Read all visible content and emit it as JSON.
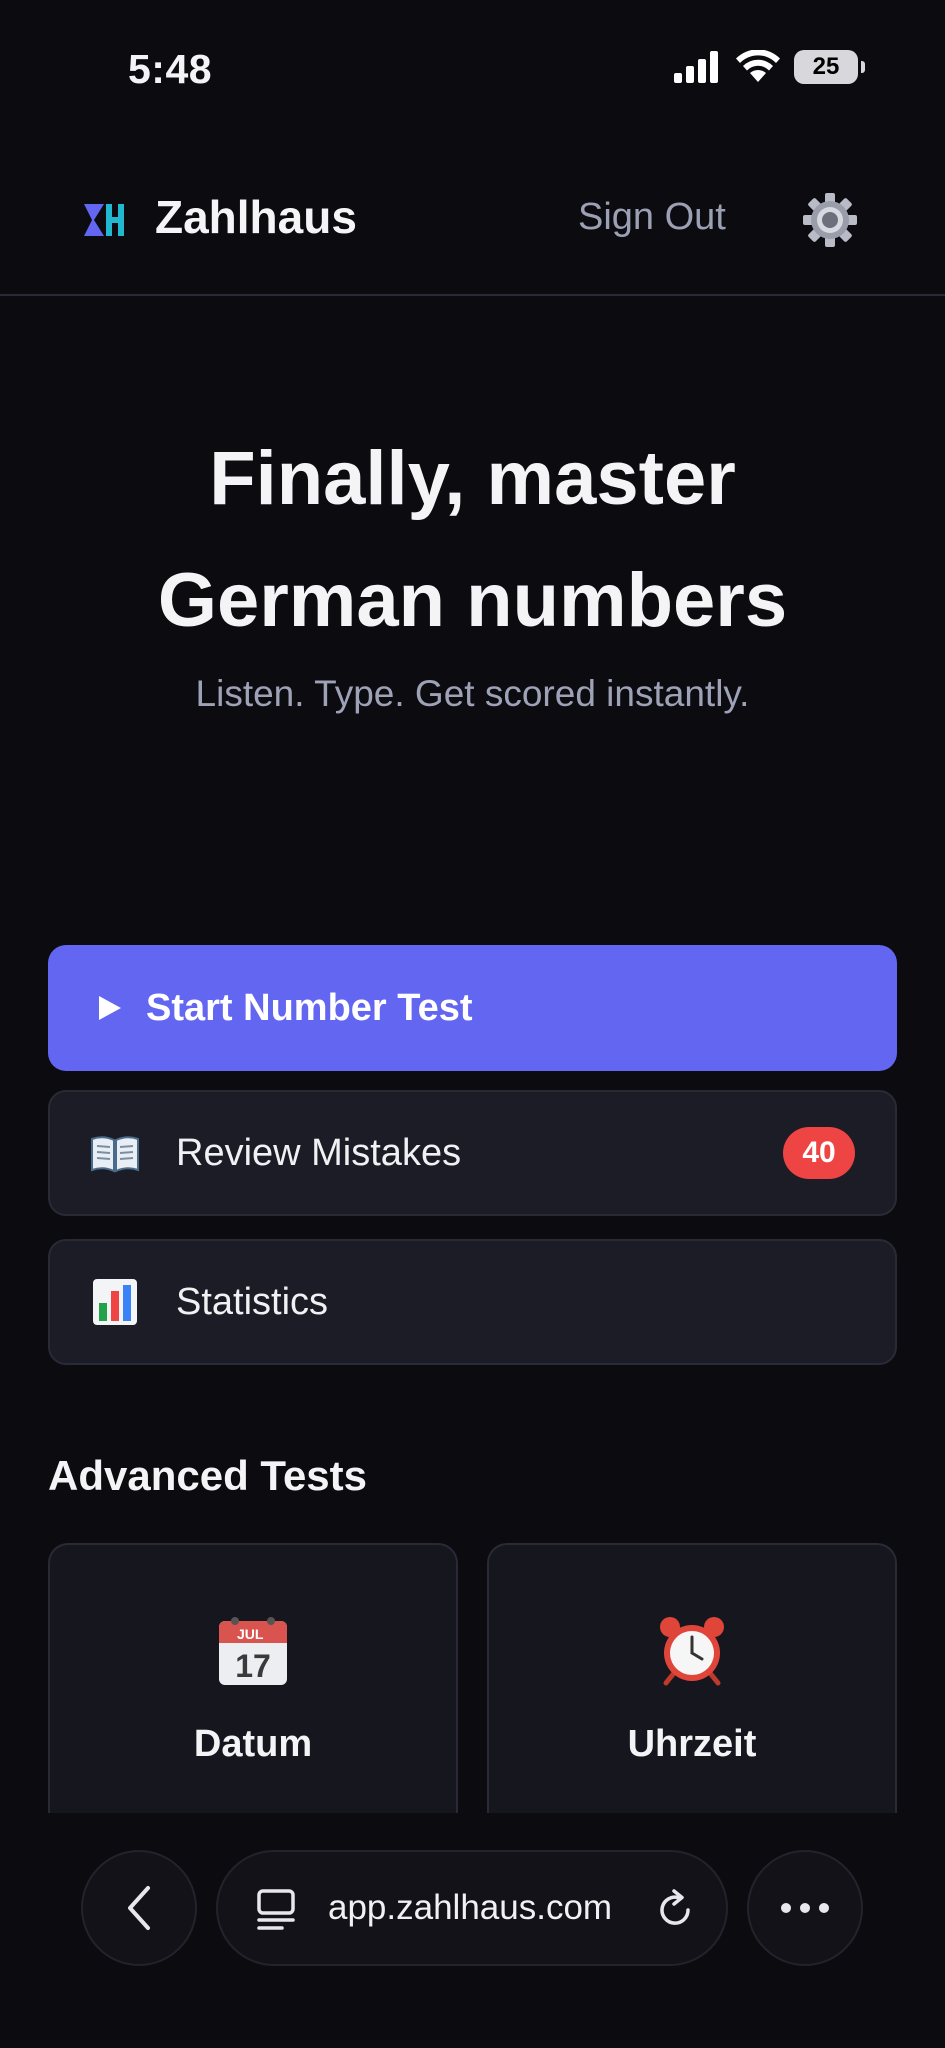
{
  "status_bar": {
    "time": "5:48",
    "battery": "25",
    "icons": [
      "signal-icon",
      "wifi-icon",
      "battery-icon"
    ]
  },
  "header": {
    "app_name": "Zahlhaus",
    "sign_out_label": "Sign Out",
    "logo_icon": "zahlhaus-logo-icon",
    "settings_icon": "gear-icon"
  },
  "hero": {
    "title_line1": "Finally, master",
    "title_line2": "German numbers",
    "subtitle": "Listen. Type. Get scored instantly."
  },
  "actions": {
    "start": {
      "label": "Start Number Test",
      "icon": "play-icon"
    },
    "review": {
      "label": "Review Mistakes",
      "icon": "open-book-icon",
      "badge": "40"
    },
    "stats": {
      "label": "Statistics",
      "icon": "bar-chart-icon"
    }
  },
  "advanced": {
    "title": "Advanced Tests",
    "cards": [
      {
        "label": "Datum",
        "icon": "calendar-icon",
        "calendar_month": "JUL",
        "calendar_day": "17"
      },
      {
        "label": "Uhrzeit",
        "icon": "alarm-clock-icon"
      }
    ]
  },
  "browser": {
    "url": "app.zahlhaus.com",
    "icons": [
      "back-chevron-icon",
      "tabs-icon",
      "reload-icon",
      "more-icon"
    ]
  },
  "colors": {
    "background": "#0b0b10",
    "primary": "#6366f1",
    "card": "#1c1c26",
    "badge": "#ef4444",
    "muted_text": "#9ca0b4"
  }
}
